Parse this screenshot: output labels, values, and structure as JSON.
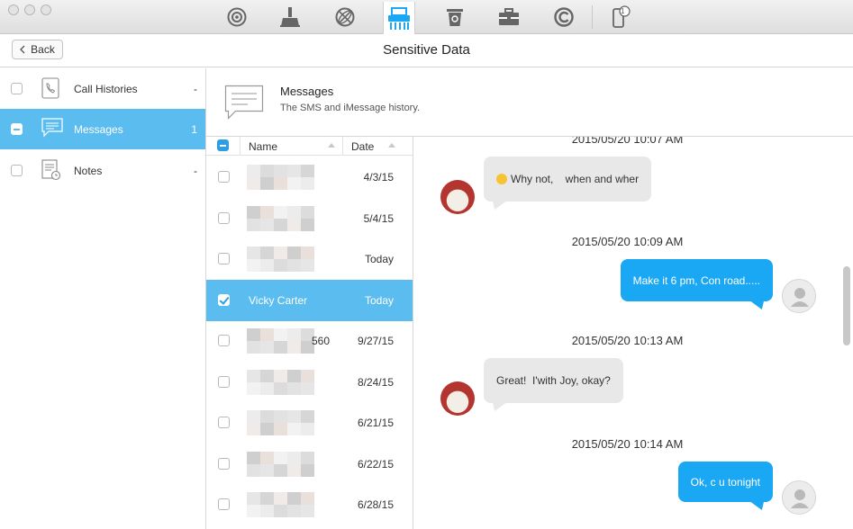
{
  "toolbar": {
    "tools": [
      {
        "icon": "airplay-icon"
      },
      {
        "icon": "cleaner-icon"
      },
      {
        "icon": "internet-icon"
      },
      {
        "icon": "privacy-shredder-icon",
        "active": true
      },
      {
        "icon": "trash-icon"
      },
      {
        "icon": "toolbox-icon"
      },
      {
        "icon": "update-icon"
      },
      {
        "icon": "device-icon",
        "badge": "1"
      }
    ]
  },
  "nav": {
    "back_label": "Back",
    "title": "Sensitive Data"
  },
  "sidebar": {
    "items": [
      {
        "label": "Call Histories",
        "count": "-",
        "icon": "phone-icon",
        "selected": false
      },
      {
        "label": "Messages",
        "count": "1",
        "icon": "message-icon",
        "selected": true
      },
      {
        "label": "Notes",
        "count": "-",
        "icon": "notes-icon",
        "selected": false
      }
    ]
  },
  "category": {
    "title": "Messages",
    "subtitle": "The SMS and iMessage history."
  },
  "list": {
    "columns": {
      "name": "Name",
      "date": "Date"
    },
    "rows": [
      {
        "name": "",
        "date": "4/3/15"
      },
      {
        "name": "",
        "date": "5/4/15"
      },
      {
        "name": "",
        "date": "Today"
      },
      {
        "name": "Vicky Carter",
        "date": "Today",
        "selected": true
      },
      {
        "name": "560",
        "date": "9/27/15"
      },
      {
        "name": "",
        "date": "8/24/15"
      },
      {
        "name": "",
        "date": "6/21/15"
      },
      {
        "name": "",
        "date": "6/22/15"
      },
      {
        "name": "",
        "date": "6/28/15"
      }
    ]
  },
  "conversation": {
    "messages": [
      {
        "timestamp": "2015/05/20 10:07 AM",
        "text": "Why not,    when and wher",
        "direction": "in",
        "emoji": "smile-emoji-icon"
      },
      {
        "timestamp": "2015/05/20 10:09 AM",
        "text": "Make it 6 pm, Con road.....",
        "direction": "out"
      },
      {
        "timestamp": "2015/05/20 10:13 AM",
        "text": "Great!  I'with Joy, okay?",
        "direction": "in"
      },
      {
        "timestamp": "2015/05/20 10:14 AM",
        "text": "Ok, c u tonight",
        "direction": "out"
      }
    ]
  },
  "colors": {
    "accent": "#5bbcf0",
    "outgoing_bubble": "#1aa7f4",
    "incoming_bubble": "#e8e8e8"
  }
}
